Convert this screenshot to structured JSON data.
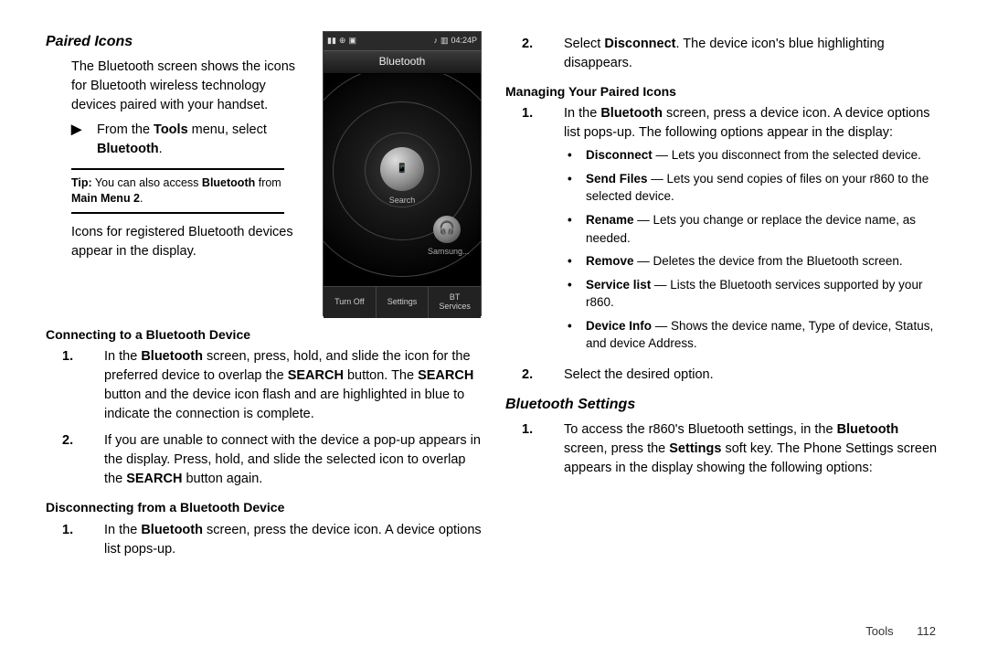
{
  "left": {
    "h_paired": "Paired Icons",
    "intro1": "The Bluetooth screen shows the icons for Bluetooth wireless technology devices paired with your handset.",
    "arrow_pre": "From the ",
    "arrow_b1": "Tools",
    "arrow_mid": " menu, select ",
    "arrow_b2": "Bluetooth",
    "arrow_post": ".",
    "tip_label": "Tip:",
    "tip_pre": " You can also access ",
    "tip_b": "Bluetooth",
    "tip_mid": " from ",
    "tip_b2": "Main Menu 2",
    "tip_post": ".",
    "registered": "Icons for registered Bluetooth devices appear in the display.",
    "h_connect": "Connecting to a Bluetooth Device",
    "c1_a": "In the ",
    "c1_b": "Bluetooth",
    "c1_c": " screen, press, hold, and slide the icon for the preferred device to overlap the ",
    "c1_d": "SEARCH",
    "c1_e": " button. The ",
    "c1_f": "SEARCH",
    "c1_g": " button and the device icon flash and are highlighted in blue to indicate the connection is complete.",
    "c2_a": "If you are unable to connect with the device a pop-up appears in the display. Press, hold, and slide the selected icon to overlap the ",
    "c2_b": "SEARCH",
    "c2_c": " button again.",
    "h_disconnect": "Disconnecting from a Bluetooth Device",
    "d1_a": "In the ",
    "d1_b": "Bluetooth",
    "d1_c": " screen, press the device icon. A device options list pops-up."
  },
  "right": {
    "r2_a": "Select ",
    "r2_b": "Disconnect",
    "r2_c": ". The device icon's blue highlighting disappears.",
    "h_manage": "Managing Your Paired Icons",
    "m1_a": "In the ",
    "m1_b": "Bluetooth",
    "m1_c": " screen, press a device icon. A device options list pops-up. The following options appear in the display:",
    "opt_disconnect_b": "Disconnect",
    "opt_disconnect": " — Lets you disconnect from the selected device.",
    "opt_send_b": "Send Files",
    "opt_send": " — Lets you send copies of files on your r860 to the selected device.",
    "opt_rename_b": "Rename",
    "opt_rename": " — Lets you change or replace the device name, as needed.",
    "opt_remove_b": "Remove",
    "opt_remove": " — Deletes the device from the Bluetooth screen.",
    "opt_service_b": "Service list",
    "opt_service": " — Lists the Bluetooth services supported by your r860.",
    "opt_info_b": "Device Info",
    "opt_info": " — Shows the device name, Type of device, Status, and device Address.",
    "m2": "Select the desired option.",
    "h_settings": "Bluetooth Settings",
    "s1_a": "To access the r860's Bluetooth settings, in the ",
    "s1_b": "Bluetooth",
    "s1_c": " screen, press the ",
    "s1_d": "Settings",
    "s1_e": " soft key. The Phone Settings screen appears in the display showing the following options:"
  },
  "phone": {
    "time": "04:24P",
    "title": "Bluetooth",
    "center": "📱",
    "center_label": "Search",
    "sat": "🎧",
    "sat_label": "Samsung...",
    "sk1": "Turn Off",
    "sk2": "Settings",
    "sk3": "BT\nServices"
  },
  "footer": {
    "section": "Tools",
    "page": "112"
  }
}
